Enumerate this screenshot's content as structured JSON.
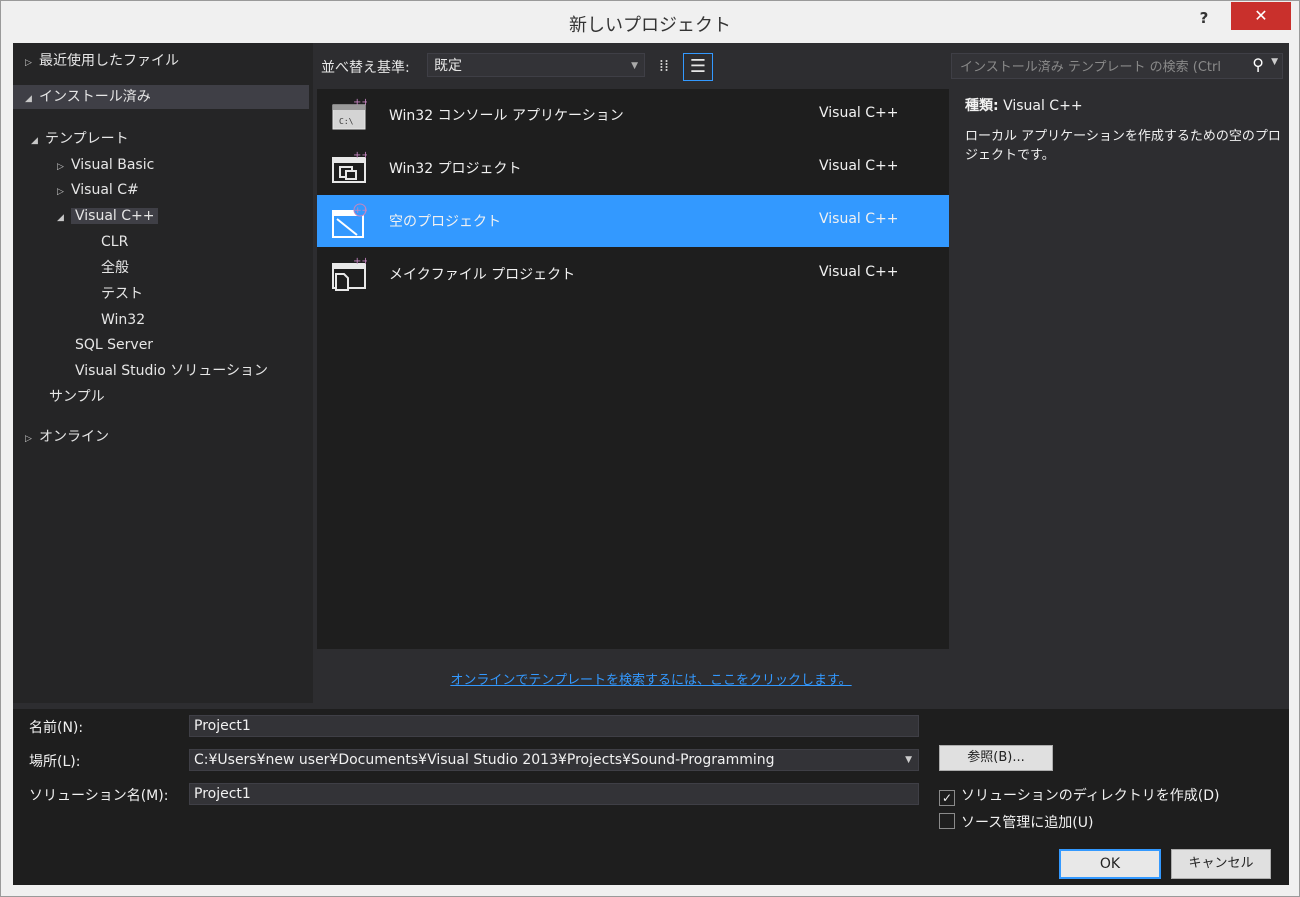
{
  "window": {
    "title": "新しいプロジェクト",
    "help_label": "?",
    "close_label": "✕"
  },
  "tree": {
    "recent": "最近使用したファイル",
    "installed": "インストール済み",
    "templates": "テンプレート",
    "visual_basic": "Visual Basic",
    "visual_csharp": "Visual C#",
    "visual_cpp": "Visual C++",
    "clr": "CLR",
    "general": "全般",
    "test": "テスト",
    "win32": "Win32",
    "sql_server": "SQL Server",
    "vs_solution": "Visual Studio ソリューション",
    "samples": "サンプル",
    "online": "オンライン"
  },
  "toolbar": {
    "sort_label": "並べ替え基準:",
    "sort_value": "既定",
    "search_placeholder": "インストール済み テンプレート の検索 (Ctrl"
  },
  "templates": [
    {
      "name": "Win32 コンソール アプリケーション",
      "lang": "Visual C++",
      "icon": "console-app-icon",
      "selected": false
    },
    {
      "name": "Win32 プロジェクト",
      "lang": "Visual C++",
      "icon": "win32-project-icon",
      "selected": false
    },
    {
      "name": "空のプロジェクト",
      "lang": "Visual C++",
      "icon": "empty-project-icon",
      "selected": true
    },
    {
      "name": "メイクファイル プロジェクト",
      "lang": "Visual C++",
      "icon": "makefile-project-icon",
      "selected": false
    }
  ],
  "description": {
    "kind_label": "種類:",
    "kind_value": "Visual C++",
    "text": "ローカル アプリケーションを作成するための空のプロジェクトです。"
  },
  "online_link": "オンラインでテンプレートを検索するには、ここをクリックします。",
  "form": {
    "name_label": "名前(N):",
    "name_value": "Project1",
    "location_label": "場所(L):",
    "location_value": "C:¥Users¥new user¥Documents¥Visual Studio 2013¥Projects¥Sound-Programming",
    "solution_label": "ソリューション名(M):",
    "solution_value": "Project1",
    "browse_label": "参照(B)...",
    "create_dir_label": "ソリューションのディレクトリを作成(D)",
    "create_dir_checked": true,
    "source_control_label": "ソース管理に追加(U)",
    "source_control_checked": false,
    "ok_label": "OK",
    "cancel_label": "キャンセル"
  },
  "colors": {
    "accent": "#3399ff",
    "panel": "#252526",
    "list_bg": "#1e1e1e",
    "close": "#c9302c",
    "icon_plus": "#c586c0"
  }
}
